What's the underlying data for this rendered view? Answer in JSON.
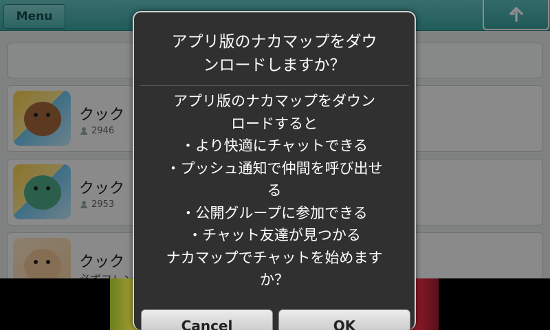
{
  "header": {
    "menu_label": "Menu"
  },
  "list": {
    "items": [
      {
        "name": "クック",
        "count": "2946"
      },
      {
        "name": "クック",
        "count": "2953"
      },
      {
        "name": "クック",
        "desc": "必ずフレン"
      }
    ]
  },
  "dialog": {
    "title_lines": [
      "アプリ版のナカマップをダウ",
      "ンロードしますか？"
    ],
    "message_lines": [
      "アプリ版のナカマップをダウン",
      "ロードすると",
      "・より快適にチャットできる",
      "・プッシュ通知で仲間を呼び出せ",
      "る",
      "・公開グループに参加できる",
      "・チャット友達が見つかる",
      "ナカマップでチャットを始めます",
      "か？"
    ],
    "cancel_label": "Cancel",
    "ok_label": "OK"
  },
  "colors": {
    "accent": "#3aa8a6",
    "dialog_bg": "#303030"
  }
}
